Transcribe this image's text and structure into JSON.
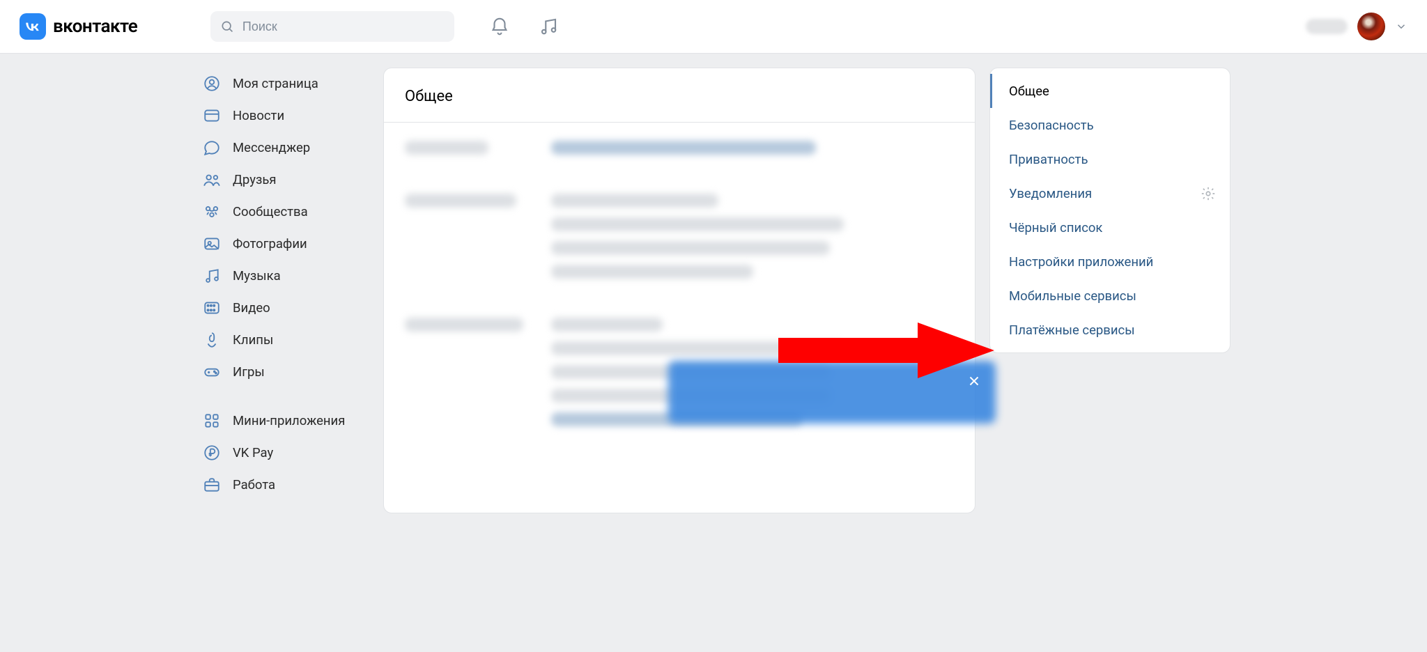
{
  "header": {
    "brand": "вконтакте",
    "search_placeholder": "Поиск"
  },
  "nav": {
    "items": [
      {
        "id": "my-page",
        "label": "Моя страница",
        "icon": "user-circle"
      },
      {
        "id": "news",
        "label": "Новости",
        "icon": "newspaper"
      },
      {
        "id": "messenger",
        "label": "Мессенджер",
        "icon": "chat"
      },
      {
        "id": "friends",
        "label": "Друзья",
        "icon": "friends"
      },
      {
        "id": "communities",
        "label": "Сообщества",
        "icon": "communities"
      },
      {
        "id": "photos",
        "label": "Фотографии",
        "icon": "photo"
      },
      {
        "id": "music",
        "label": "Музыка",
        "icon": "music"
      },
      {
        "id": "video",
        "label": "Видео",
        "icon": "video"
      },
      {
        "id": "clips",
        "label": "Клипы",
        "icon": "clip"
      },
      {
        "id": "games",
        "label": "Игры",
        "icon": "gamepad"
      }
    ],
    "secondary": [
      {
        "id": "miniapps",
        "label": "Мини-приложения",
        "icon": "grid"
      },
      {
        "id": "vkpay",
        "label": "VK Pay",
        "icon": "ruble"
      },
      {
        "id": "work",
        "label": "Работа",
        "icon": "briefcase"
      }
    ]
  },
  "main": {
    "title": "Общее"
  },
  "settings_nav": {
    "items": [
      {
        "label": "Общее",
        "active": true,
        "gear": false
      },
      {
        "label": "Безопасность",
        "active": false,
        "gear": false
      },
      {
        "label": "Приватность",
        "active": false,
        "gear": false
      },
      {
        "label": "Уведомления",
        "active": false,
        "gear": true
      },
      {
        "label": "Чёрный список",
        "active": false,
        "gear": false
      },
      {
        "label": "Настройки приложений",
        "active": false,
        "gear": false
      },
      {
        "label": "Мобильные сервисы",
        "active": false,
        "gear": false
      },
      {
        "label": "Платёжные сервисы",
        "active": false,
        "gear": false
      }
    ]
  },
  "annotation": {
    "target": "Платёжные сервисы",
    "color": "#fe0000"
  }
}
